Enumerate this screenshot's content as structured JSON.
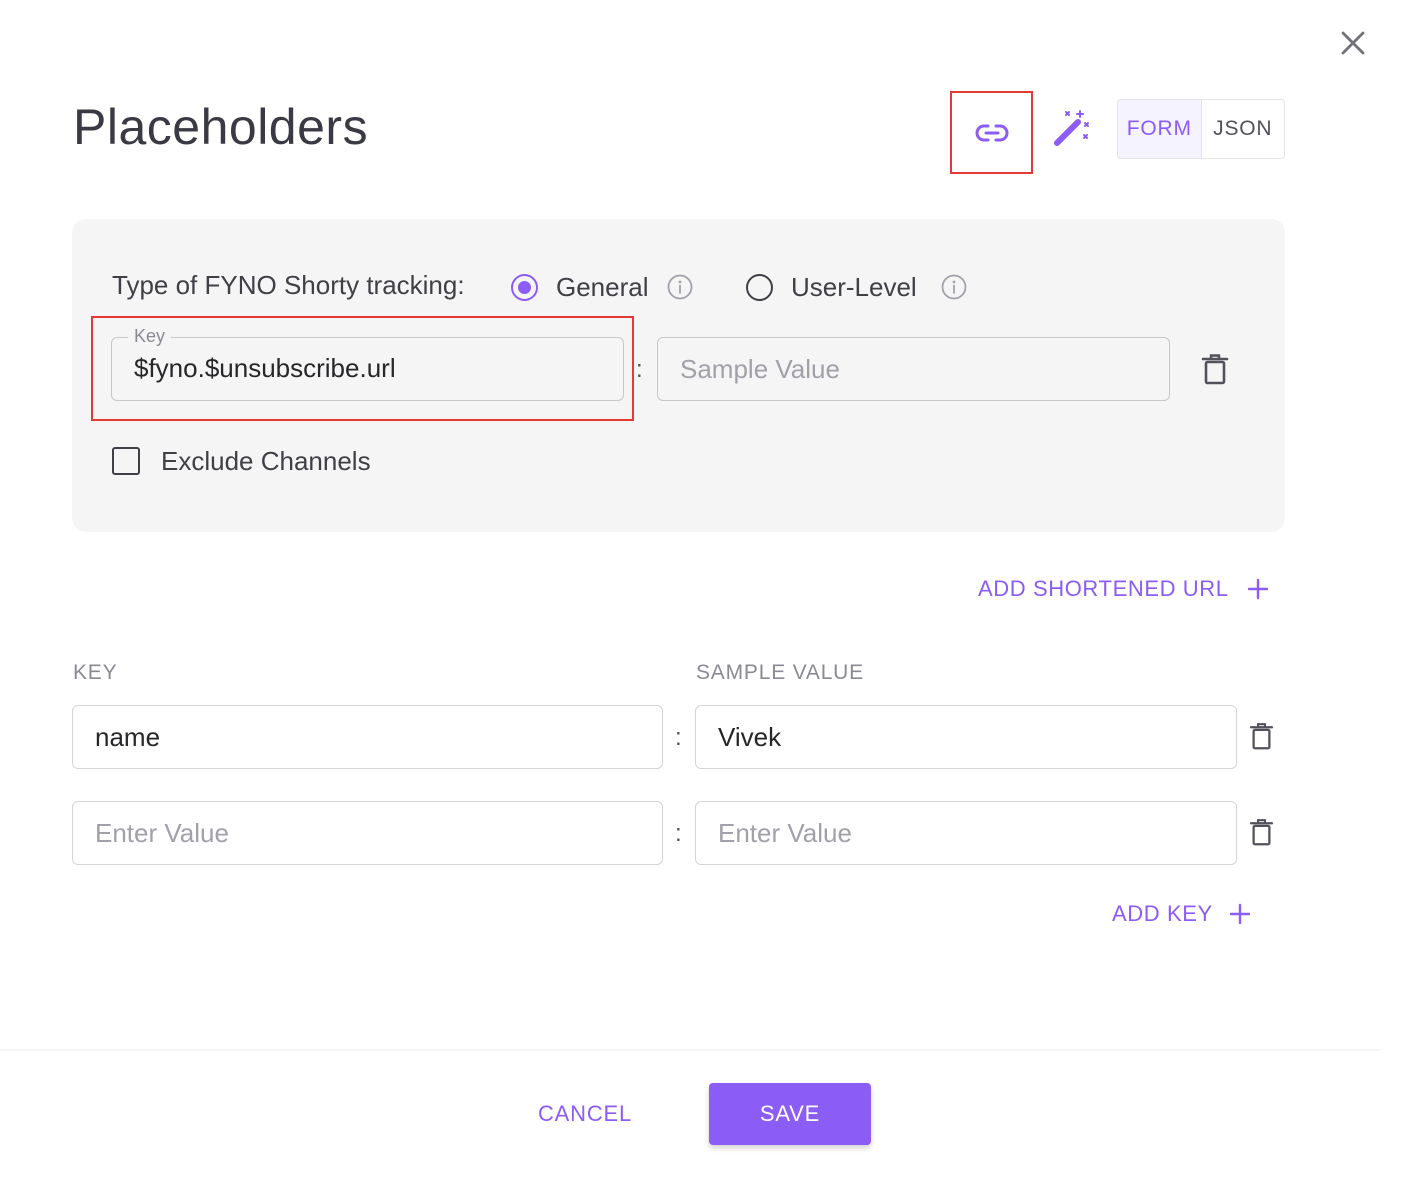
{
  "dialog": {
    "title": "Placeholders",
    "close_icon": "close-icon"
  },
  "toolbar": {
    "link_icon": "link-icon",
    "magic_icon": "magic-wand-icon",
    "view_toggle": {
      "options": [
        "FORM",
        "JSON"
      ],
      "selected": "FORM"
    }
  },
  "tracking": {
    "label": "Type of FYNO Shorty tracking:",
    "options": [
      {
        "label": "General",
        "selected": true
      },
      {
        "label": "User-Level",
        "selected": false
      }
    ],
    "key_legend": "Key",
    "key_value": "$fyno.$unsubscribe.url",
    "separator": ":",
    "sample_placeholder": "Sample Value",
    "sample_value": "",
    "exclude_label": "Exclude Channels",
    "exclude_checked": false
  },
  "add_shortened_url_label": "ADD SHORTENED URL",
  "columns": {
    "key": "KEY",
    "sample_value": "SAMPLE VALUE"
  },
  "rows": [
    {
      "key": "name",
      "value": "Vivek",
      "key_placeholder": "Enter Value",
      "value_placeholder": "Enter Value"
    },
    {
      "key": "",
      "value": "",
      "key_placeholder": "Enter Value",
      "value_placeholder": "Enter Value"
    }
  ],
  "add_key_label": "ADD KEY",
  "footer": {
    "cancel_label": "CANCEL",
    "save_label": "SAVE"
  },
  "colors": {
    "accent": "#8b5cf6",
    "highlight": "#e53935",
    "panel_bg": "#f5f5f5"
  }
}
